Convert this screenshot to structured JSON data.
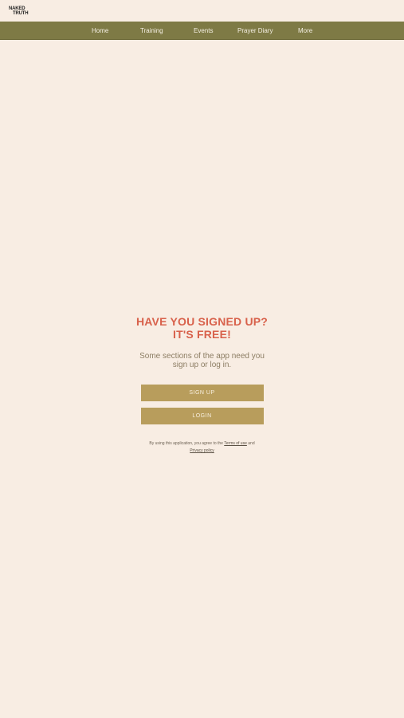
{
  "brand": {
    "logo_line1": "NAKED",
    "logo_line2": "TRUTH"
  },
  "nav": {
    "items": [
      {
        "label": "Home"
      },
      {
        "label": "Training"
      },
      {
        "label": "Events"
      },
      {
        "label": "Prayer Diary"
      },
      {
        "label": "More"
      }
    ]
  },
  "main": {
    "headline_line1": "HAVE YOU SIGNED UP?",
    "headline_line2": "IT'S FREE!",
    "subtext": "Some sections of the app need you sign up or log in.",
    "signup_label": "SIGN UP",
    "login_label": "LOGIN"
  },
  "legal": {
    "prefix": "By using this application, you agree to the ",
    "terms_link": "Terms of use",
    "middle": " and ",
    "privacy_link": "Privacy policy"
  },
  "colors": {
    "background": "#f8ede3",
    "navbar": "#7e7a45",
    "headline": "#d8614b",
    "button": "#b89d5c"
  }
}
